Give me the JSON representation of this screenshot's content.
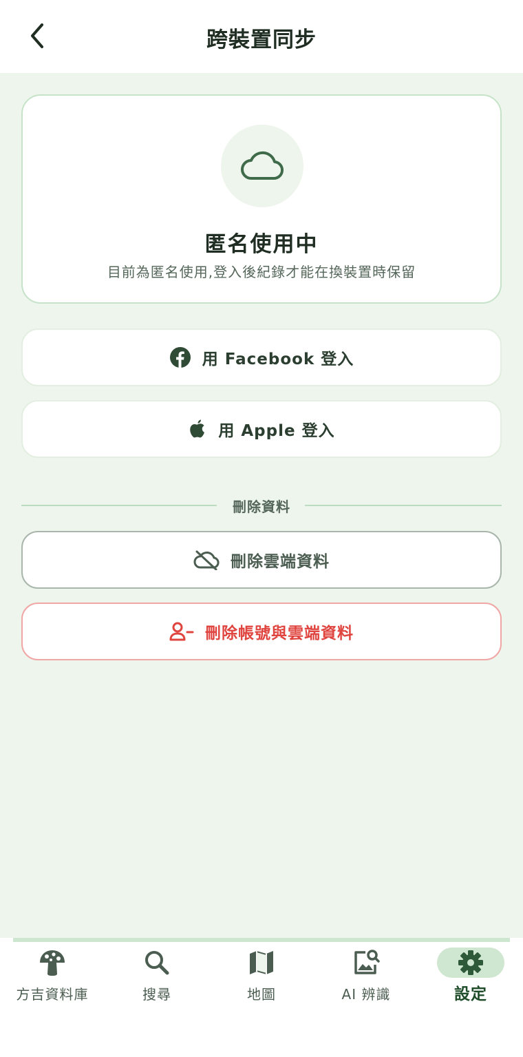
{
  "header": {
    "title": "跨裝置同步",
    "back_icon": "chevron-left-icon"
  },
  "status_card": {
    "icon": "cloud-icon",
    "title": "匿名使用中",
    "description": "目前為匿名使用,登入後紀錄才能在換裝置時保留"
  },
  "login": {
    "facebook_label": "用 Facebook 登入",
    "apple_label": "用 Apple 登入"
  },
  "delete_section": {
    "divider_label": "刪除資料",
    "delete_cloud_label": "刪除雲端資料",
    "delete_account_label": "刪除帳號與雲端資料"
  },
  "nav": {
    "items": [
      {
        "label": "方吉資料庫",
        "icon": "mushroom-icon"
      },
      {
        "label": "搜尋",
        "icon": "search-icon"
      },
      {
        "label": "地圖",
        "icon": "map-icon"
      },
      {
        "label": "AI 辨識",
        "icon": "image-search-icon"
      },
      {
        "label": "設定",
        "icon": "gear-icon",
        "active": true
      }
    ]
  },
  "colors": {
    "primary": "#2f5a3a",
    "background": "#eef5ec",
    "danger": "#e0443f",
    "border_green": "#c6e3c8"
  }
}
